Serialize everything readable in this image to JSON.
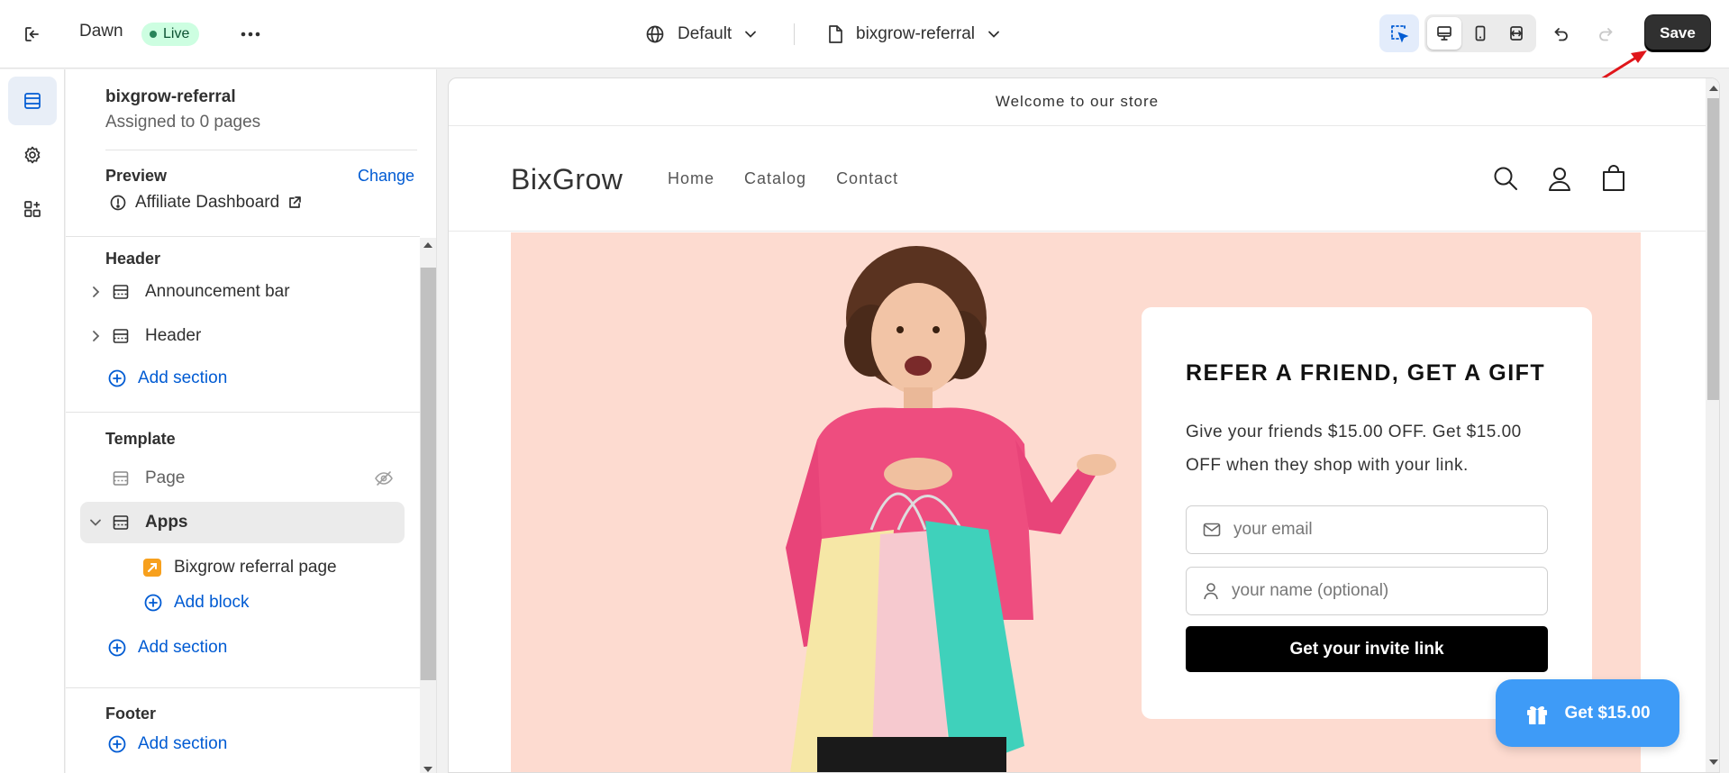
{
  "topbar": {
    "theme_name": "Dawn",
    "status": "Live",
    "language": "Default",
    "template": "bixgrow-referral",
    "save_label": "Save"
  },
  "sidebar": {
    "title": "bixgrow-referral",
    "subtitle": "Assigned to 0 pages",
    "preview_label": "Preview",
    "change_label": "Change",
    "preview_page": "Affiliate Dashboard",
    "groups": {
      "header": {
        "title": "Header",
        "items": [
          "Announcement bar",
          "Header"
        ],
        "add_label": "Add section"
      },
      "template": {
        "title": "Template",
        "items": [
          "Page",
          "Apps"
        ],
        "block": "Bixgrow referral page",
        "add_block_label": "Add block",
        "add_label": "Add section"
      },
      "footer": {
        "title": "Footer",
        "add_label": "Add section"
      }
    }
  },
  "store": {
    "announcement": "Welcome to our store",
    "logo": "BixGrow",
    "nav": [
      "Home",
      "Catalog",
      "Contact"
    ],
    "card": {
      "title": "REFER A FRIEND, GET A GIFT",
      "description": "Give your friends $15.00 OFF. Get $15.00 OFF when they shop with your link.",
      "email_placeholder": "your email",
      "name_placeholder": "your name (optional)",
      "cta": "Get your invite link"
    },
    "floating_button": "Get $15.00"
  },
  "colors": {
    "accent_link": "#005bd3",
    "save_button": "#303030",
    "live_badge": "#cdfee1",
    "hero_background": "#fddbd0",
    "floating_button": "#3e9bf7",
    "annotation_arrow": "#e0161b"
  },
  "icons": {
    "exit": "exit-icon",
    "more": "more-horizontal-icon",
    "language": "globe-icon",
    "template": "page-icon",
    "inspector": "select-inspector-icon",
    "desktop": "desktop-icon",
    "mobile": "mobile-icon",
    "fullwidth": "fullwidth-icon",
    "undo": "undo-icon",
    "redo": "redo-icon",
    "sections": "sections-icon",
    "settings": "gear-icon",
    "apps": "apps-icon",
    "search": "search-icon",
    "account": "user-icon",
    "cart": "cart-icon",
    "gift": "gift-icon"
  }
}
